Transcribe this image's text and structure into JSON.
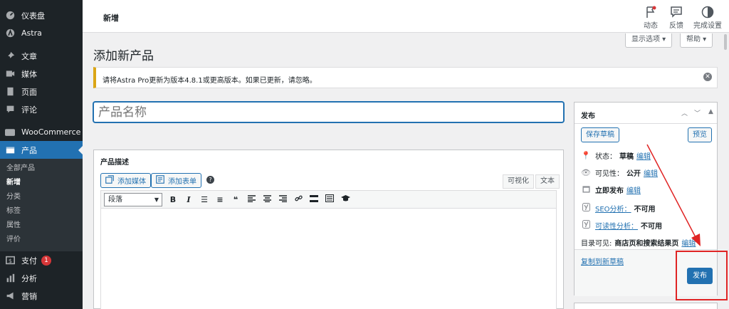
{
  "sidebar": {
    "items": [
      {
        "label": "仪表盘",
        "icon": "dashboard-icon"
      },
      {
        "label": "Astra",
        "icon": "astra-icon"
      },
      {
        "label": "文章",
        "icon": "pin-icon"
      },
      {
        "label": "媒体",
        "icon": "media-icon"
      },
      {
        "label": "页面",
        "icon": "page-icon"
      },
      {
        "label": "评论",
        "icon": "comment-icon"
      },
      {
        "label": "WooCommerce",
        "icon": "woo-icon"
      },
      {
        "label": "产品",
        "icon": "product-icon"
      }
    ],
    "submenu": [
      "全部产品",
      "新增",
      "分类",
      "标签",
      "属性",
      "评价"
    ],
    "after": [
      {
        "label": "支付",
        "icon": "payment-icon",
        "badge": "1"
      },
      {
        "label": "分析",
        "icon": "analytics-icon"
      },
      {
        "label": "营销",
        "icon": "marketing-icon"
      }
    ]
  },
  "header": {
    "title": "新增",
    "actions": [
      {
        "label": "动态",
        "icon": "flag-icon"
      },
      {
        "label": "反馈",
        "icon": "feedback-icon"
      },
      {
        "label": "完成设置",
        "icon": "setup-icon"
      }
    ],
    "screen_options": "显示选项",
    "help": "帮助"
  },
  "page": {
    "title": "添加新产品",
    "notice": "请将Astra Pro更新为版本4.8.1或更高版本。如果已更新，请忽略。",
    "title_placeholder": "产品名称"
  },
  "description": {
    "heading": "产品描述",
    "add_media": "添加媒体",
    "add_form": "添加表单",
    "tab_visual": "可视化",
    "tab_text": "文本",
    "format": "段落"
  },
  "publish": {
    "heading": "发布",
    "save_draft": "保存草稿",
    "preview": "预览",
    "status_label": "状态：",
    "status_value": "草稿",
    "visibility_label": "可见性：",
    "visibility_value": "公开",
    "publish_now": "立即发布",
    "edit": "编辑",
    "seo_label": "SEO分析：",
    "seo_value": "不可用",
    "read_label": "可读性分析：",
    "read_value": "不可用",
    "catalog_label": "目录可见:",
    "catalog_value": "商店页和搜索结果页",
    "copy_draft": "复制到新草稿",
    "publish_button": "发布"
  },
  "colors": {
    "accent": "#2271b1",
    "sidebar": "#1d2327",
    "highlight": "#e02424"
  }
}
